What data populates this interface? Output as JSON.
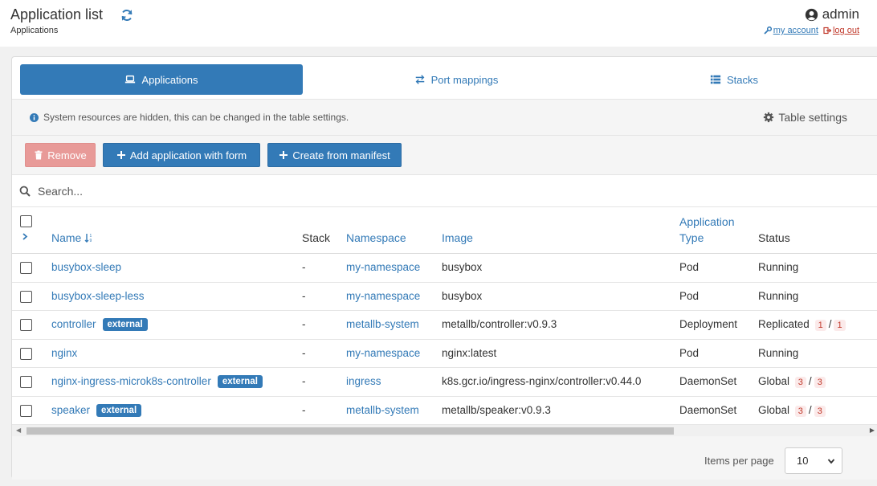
{
  "header": {
    "title": "Application list",
    "breadcrumb": "Applications",
    "username": "admin",
    "my_account": "my account",
    "log_out": "log out"
  },
  "tabs": [
    {
      "label": "Applications",
      "icon": "laptop-icon",
      "active": true
    },
    {
      "label": "Port mappings",
      "icon": "exchange-icon",
      "active": false
    },
    {
      "label": "Stacks",
      "icon": "list-icon",
      "active": false
    }
  ],
  "info": {
    "text": "System resources are hidden, this can be changed in the table settings.",
    "table_settings": "Table settings"
  },
  "actions": {
    "remove": "Remove",
    "add_with_form": "Add application with form",
    "create_from_manifest": "Create from manifest"
  },
  "search": {
    "placeholder": "Search..."
  },
  "columns": {
    "name": "Name",
    "stack": "Stack",
    "namespace": "Namespace",
    "image": "Image",
    "app_type_1": "Application",
    "app_type_2": "Type",
    "status": "Status"
  },
  "rows": [
    {
      "name": "busybox-sleep",
      "external": "",
      "stack": "-",
      "namespace": "my-namespace",
      "image": "busybox",
      "type": "Pod",
      "status": "Running",
      "count_a": "",
      "sep": "",
      "count_b": ""
    },
    {
      "name": "busybox-sleep-less",
      "external": "",
      "stack": "-",
      "namespace": "my-namespace",
      "image": "busybox",
      "type": "Pod",
      "status": "Running",
      "count_a": "",
      "sep": "",
      "count_b": ""
    },
    {
      "name": "controller",
      "external": "external",
      "stack": "-",
      "namespace": "metallb-system",
      "image": "metallb/controller:v0.9.3",
      "type": "Deployment",
      "status": "Replicated",
      "count_a": "1",
      "sep": "/",
      "count_b": "1"
    },
    {
      "name": "nginx",
      "external": "",
      "stack": "-",
      "namespace": "my-namespace",
      "image": "nginx:latest",
      "type": "Pod",
      "status": "Running",
      "count_a": "",
      "sep": "",
      "count_b": ""
    },
    {
      "name": "nginx-ingress-microk8s-controller",
      "external": "external",
      "stack": "-",
      "namespace": "ingress",
      "image": "k8s.gcr.io/ingress-nginx/controller:v0.44.0",
      "type": "DaemonSet",
      "status": "Global",
      "count_a": "3",
      "sep": "/",
      "count_b": "3"
    },
    {
      "name": "speaker",
      "external": "external",
      "stack": "-",
      "namespace": "metallb-system",
      "image": "metallb/speaker:v0.9.3",
      "type": "DaemonSet",
      "status": "Global",
      "count_a": "3",
      "sep": "/",
      "count_b": "3"
    }
  ],
  "footer": {
    "items_per_page_label": "Items per page",
    "items_per_page_value": "10"
  },
  "colors": {
    "primary": "#337ab7",
    "danger": "#e89a98"
  }
}
